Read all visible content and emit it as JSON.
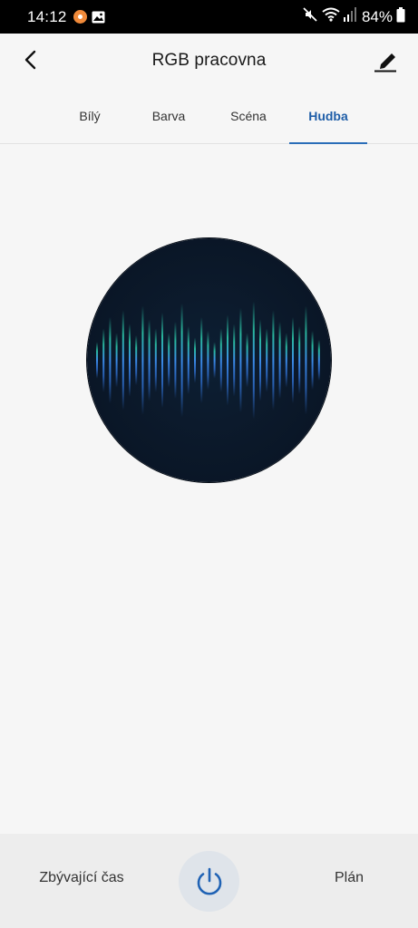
{
  "status_bar": {
    "time": "14:12",
    "battery": "84%",
    "icons": [
      "notification-app-icon",
      "gallery-icon",
      "mute-icon",
      "wifi-icon",
      "signal-icon",
      "battery-icon"
    ]
  },
  "header": {
    "title": "RGB pracovna",
    "back_icon": "chevron-left-icon",
    "edit_icon": "edit-pencil-icon"
  },
  "tabs": [
    {
      "label": "Bílý",
      "active": false
    },
    {
      "label": "Barva",
      "active": false
    },
    {
      "label": "Scéna",
      "active": false
    },
    {
      "label": "Hudba",
      "active": true
    }
  ],
  "visualizer": {
    "icon": "music-waveform-icon",
    "colors": {
      "background": "#0b1829",
      "bar_top": "#2ed1b0",
      "bar_mid": "#3b8be8"
    }
  },
  "bottom_bar": {
    "left_label": "Zbývající čas",
    "right_label": "Plán",
    "power_icon": "power-icon"
  },
  "colors": {
    "accent": "#2a6db8",
    "background": "#f6f6f6",
    "bottom_bar": "#ededed"
  }
}
